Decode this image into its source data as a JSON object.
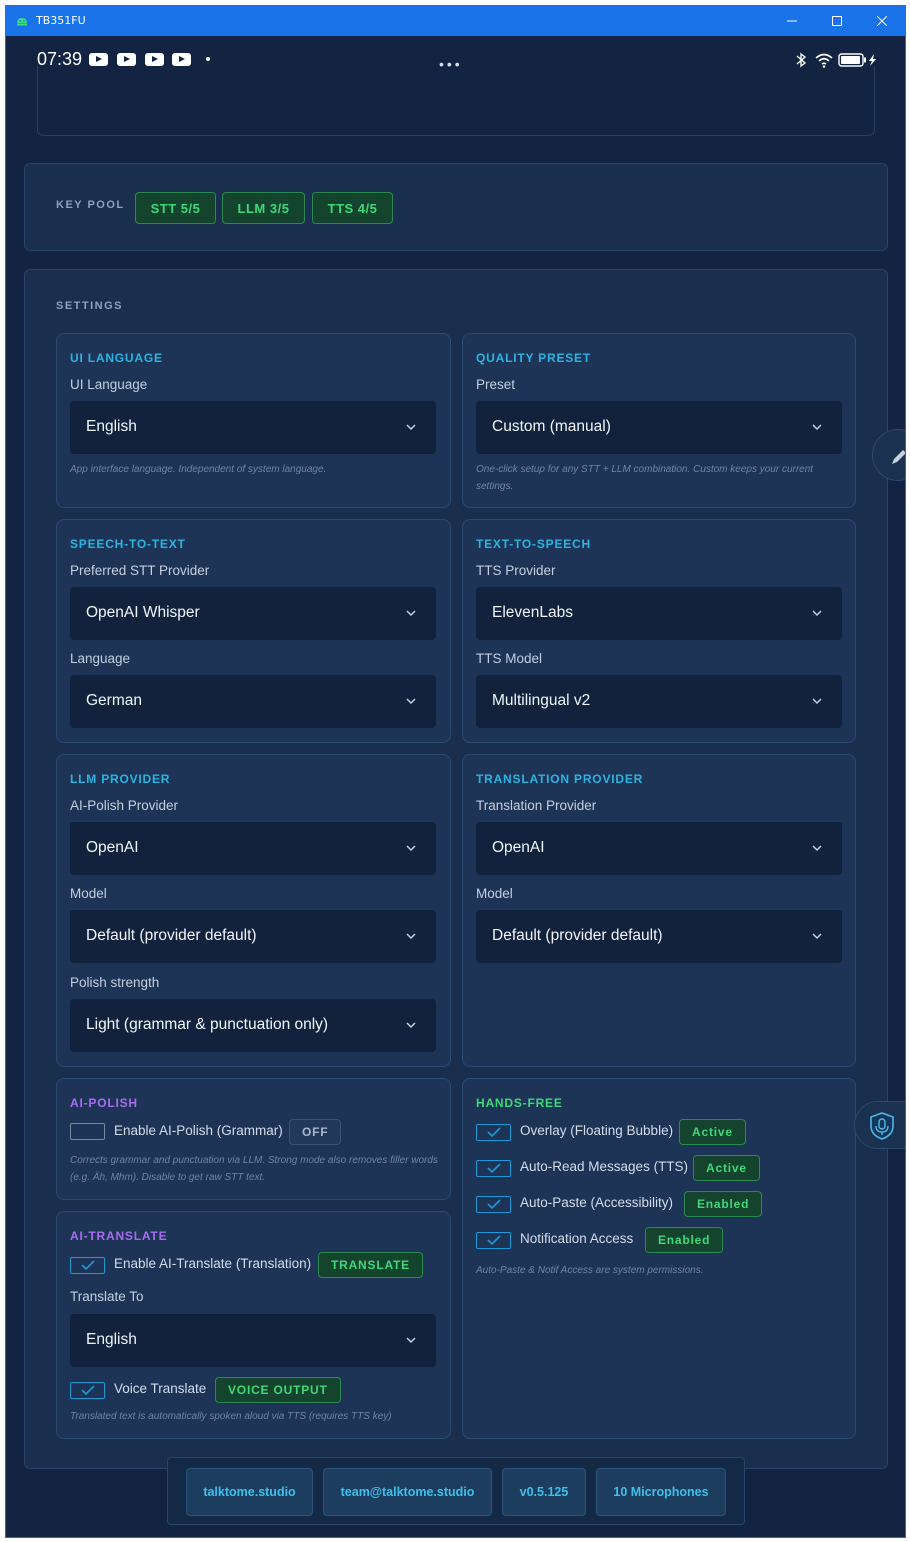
{
  "window": {
    "title": "TB351FU"
  },
  "statusbar": {
    "time": "07:39",
    "more": "•••"
  },
  "keypool": {
    "label": "KEY POOL",
    "stt": "STT 5/5",
    "llm": "LLM 3/5",
    "tts": "TTS 4/5"
  },
  "settings": {
    "label": "SETTINGS",
    "ui_language": {
      "title": "UI LANGUAGE",
      "field_label": "UI Language",
      "value": "English",
      "hint": "App interface language. Independent of system language."
    },
    "quality_preset": {
      "title": "QUALITY PRESET",
      "field_label": "Preset",
      "value": "Custom (manual)",
      "hint": "One-click setup for any STT + LLM combination. Custom keeps your current settings."
    },
    "stt": {
      "title": "SPEECH-TO-TEXT",
      "provider_label": "Preferred STT Provider",
      "provider_value": "OpenAI Whisper",
      "language_label": "Language",
      "language_value": "German"
    },
    "tts": {
      "title": "TEXT-TO-SPEECH",
      "provider_label": "TTS Provider",
      "provider_value": "ElevenLabs",
      "model_label": "TTS Model",
      "model_value": "Multilingual v2"
    },
    "llm": {
      "title": "LLM PROVIDER",
      "provider_label": "AI-Polish Provider",
      "provider_value": "OpenAI",
      "model_label": "Model",
      "model_value": "Default (provider default)",
      "strength_label": "Polish strength",
      "strength_value": "Light (grammar & punctuation only)"
    },
    "translation": {
      "title": "TRANSLATION PROVIDER",
      "provider_label": "Translation Provider",
      "provider_value": "OpenAI",
      "model_label": "Model",
      "model_value": "Default (provider default)"
    },
    "ai_polish": {
      "title": "AI-POLISH",
      "enable_label": "Enable AI-Polish (Grammar)",
      "enable_checked": false,
      "status": "OFF",
      "hint": "Corrects grammar and punctuation via LLM. Strong mode also removes filler words (e.g. Äh, Mhm). Disable to get raw STT text."
    },
    "ai_translate": {
      "title": "AI-TRANSLATE",
      "enable_label": "Enable AI-Translate (Translation)",
      "enable_checked": true,
      "status": "TRANSLATE",
      "target_label": "Translate To",
      "target_value": "English",
      "voice_label": "Voice Translate",
      "voice_checked": true,
      "voice_status": "VOICE OUTPUT",
      "hint": "Translated text is automatically spoken aloud via TTS (requires TTS key)"
    },
    "hands_free": {
      "title": "HANDS-FREE",
      "items": [
        {
          "label": "Overlay (Floating Bubble)",
          "status": "Active",
          "checked": true
        },
        {
          "label": "Auto-Read Messages (TTS)",
          "status": "Active",
          "checked": true
        },
        {
          "label": "Auto-Paste (Accessibility)",
          "status": "Enabled",
          "checked": true
        },
        {
          "label": "Notification Access",
          "status": "Enabled",
          "checked": true
        }
      ],
      "hint": "Auto-Paste & Notif Access are system permissions."
    }
  },
  "footer": {
    "site": "talktome.studio",
    "email": "team@talktome.studio",
    "version": "v0.5.125",
    "mics": "10 Microphones"
  },
  "colors": {
    "accent_cyan": "#2bb4e2",
    "accent_purple": "#a86cf2",
    "accent_green": "#3fd879",
    "background": "#122441"
  }
}
